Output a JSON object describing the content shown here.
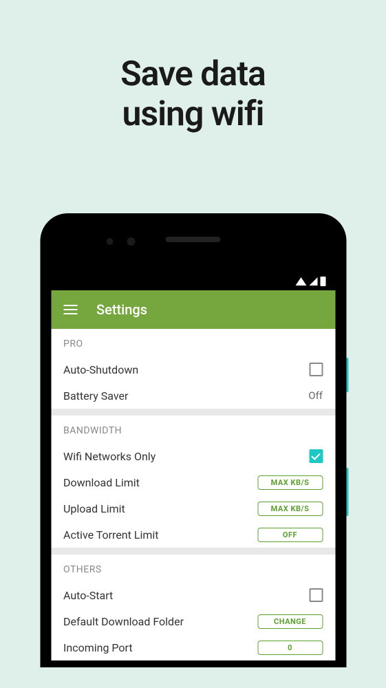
{
  "headline_line1": "Save data",
  "headline_line2": "using wifi",
  "header": {
    "title": "Settings"
  },
  "sections": {
    "pro": {
      "header": "PRO",
      "auto_shutdown_label": "Auto-Shutdown",
      "battery_saver_label": "Battery Saver",
      "battery_saver_value": "Off"
    },
    "bandwidth": {
      "header": "BANDWIDTH",
      "wifi_only_label": "Wifi Networks Only",
      "download_limit_label": "Download Limit",
      "download_limit_button": "MAX KB/S",
      "upload_limit_label": "Upload Limit",
      "upload_limit_button": "MAX KB/S",
      "active_torrent_label": "Active Torrent Limit",
      "active_torrent_button": "OFF"
    },
    "others": {
      "header": "OTHERS",
      "auto_start_label": "Auto-Start",
      "default_folder_label": "Default Download Folder",
      "default_folder_button": "CHANGE",
      "incoming_port_label": "Incoming Port",
      "incoming_port_button": "0"
    }
  }
}
